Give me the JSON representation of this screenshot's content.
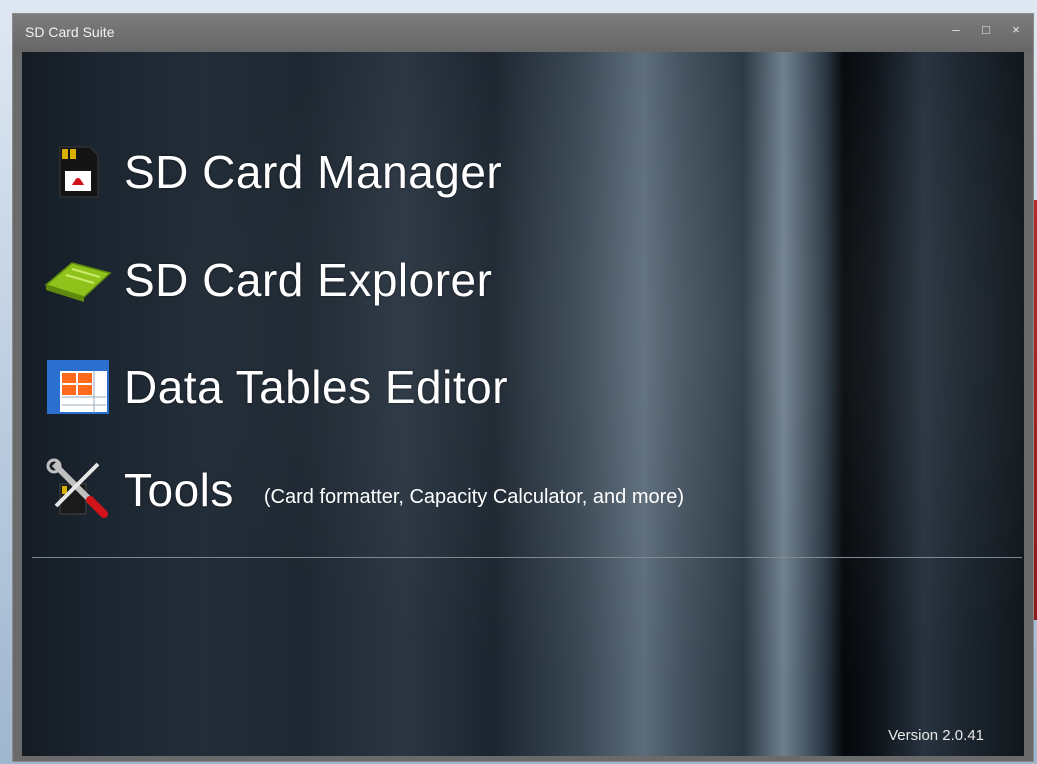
{
  "window": {
    "title": "SD Card Suite",
    "controls": {
      "minimize": "–",
      "maximize": "□",
      "close": "×"
    }
  },
  "menu": {
    "items": [
      {
        "label": "SD Card Manager",
        "icon": "sd-card-icon"
      },
      {
        "label": "SD Card Explorer",
        "icon": "green-card-explorer-icon"
      },
      {
        "label": "Data Tables Editor",
        "icon": "table-grid-icon"
      },
      {
        "label": "Tools",
        "sublabel": "(Card formatter, Capacity Calculator,  and more)",
        "icon": "tools-icon"
      }
    ]
  },
  "footer": {
    "version": "Version 2.0.41"
  },
  "colors": {
    "titlebar": "#6f6f6f",
    "text": "#ffffff",
    "divider": "#7d8791"
  }
}
